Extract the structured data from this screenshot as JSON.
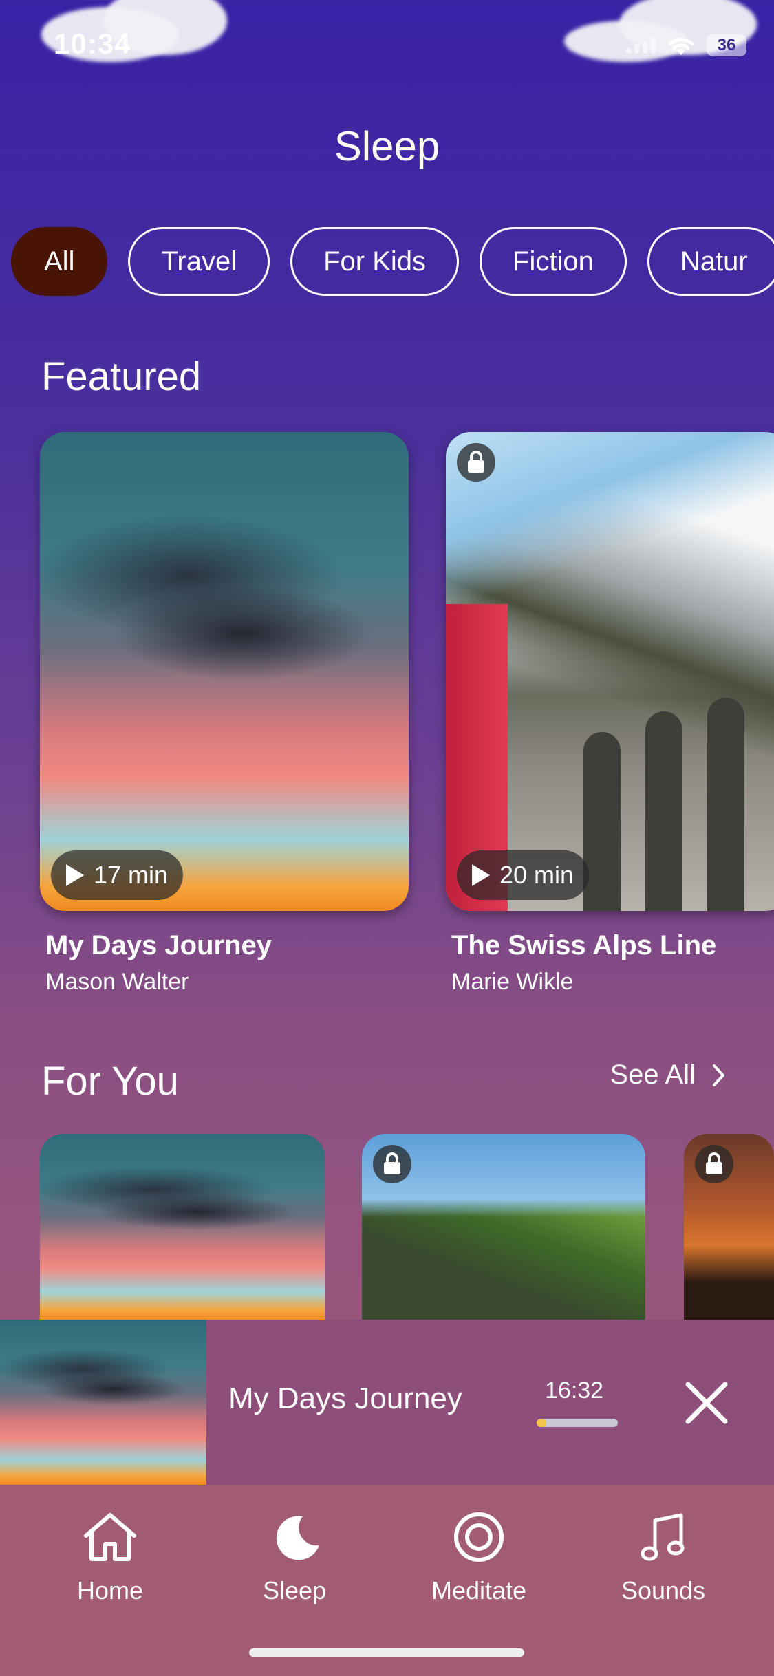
{
  "status_bar": {
    "time": "10:34",
    "battery": "36"
  },
  "page_title": "Sleep",
  "filters": {
    "items": [
      {
        "label": "All",
        "active": true
      },
      {
        "label": "Travel",
        "active": false
      },
      {
        "label": "For Kids",
        "active": false
      },
      {
        "label": "Fiction",
        "active": false
      },
      {
        "label": "Natur",
        "active": false
      }
    ]
  },
  "featured": {
    "title": "Featured",
    "items": [
      {
        "title": "My Days Journey",
        "author": "Mason Walter",
        "duration": "17 min",
        "locked": false
      },
      {
        "title": "The Swiss Alps Line",
        "author": "Marie Wikle",
        "duration": "20 min",
        "locked": true
      }
    ]
  },
  "for_you": {
    "title": "For You",
    "see_all": "See All",
    "items": [
      {
        "locked": false
      },
      {
        "locked": true
      },
      {
        "locked": true
      }
    ]
  },
  "mini_player": {
    "title": "My Days Journey",
    "time": "16:32",
    "progress": 0.12
  },
  "tabs": [
    {
      "label": "Home",
      "icon": "home-icon"
    },
    {
      "label": "Sleep",
      "icon": "moon-icon",
      "active": true
    },
    {
      "label": "Meditate",
      "icon": "target-icon"
    },
    {
      "label": "Sounds",
      "icon": "music-note-icon"
    }
  ]
}
